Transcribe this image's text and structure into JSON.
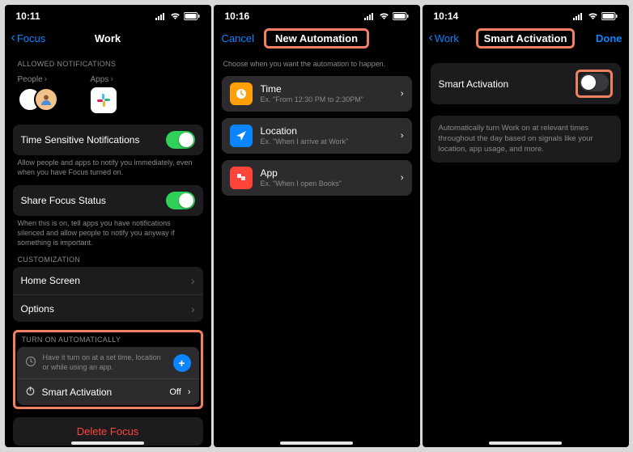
{
  "screen1": {
    "time": "10:11",
    "back": "Focus",
    "title": "Work",
    "sections": {
      "allowed_header": "ALLOWED NOTIFICATIONS",
      "people_label": "People",
      "apps_label": "Apps",
      "tsn_label": "Time Sensitive Notifications",
      "tsn_hint": "Allow people and apps to notify you immediately, even when you have Focus turned on.",
      "share_label": "Share Focus Status",
      "share_hint": "When this is on, tell apps you have notifications silenced and allow people to notify you anyway if something is important.",
      "customization_header": "CUSTOMIZATION",
      "home_screen": "Home Screen",
      "options": "Options",
      "auto_header": "TURN ON AUTOMATICALLY",
      "auto_hint": "Have it turn on at a set time, location or while using an app.",
      "smart_label": "Smart Activation",
      "smart_value": "Off",
      "delete": "Delete Focus"
    }
  },
  "screen2": {
    "time": "10:16",
    "cancel": "Cancel",
    "title": "New Automation",
    "prompt": "Choose when you want the automation to happen.",
    "items": [
      {
        "title": "Time",
        "sub": "Ex. \"From 12:30 PM to 2:30PM\""
      },
      {
        "title": "Location",
        "sub": "Ex. \"When I arrive at Work\""
      },
      {
        "title": "App",
        "sub": "Ex. \"When I open Books\""
      }
    ]
  },
  "screen3": {
    "time": "10:14",
    "back": "Work",
    "title": "Smart Activation",
    "done": "Done",
    "row_label": "Smart Activation",
    "desc": "Automatically turn Work on at relevant times throughout the day based on signals like your location, app usage, and more."
  }
}
